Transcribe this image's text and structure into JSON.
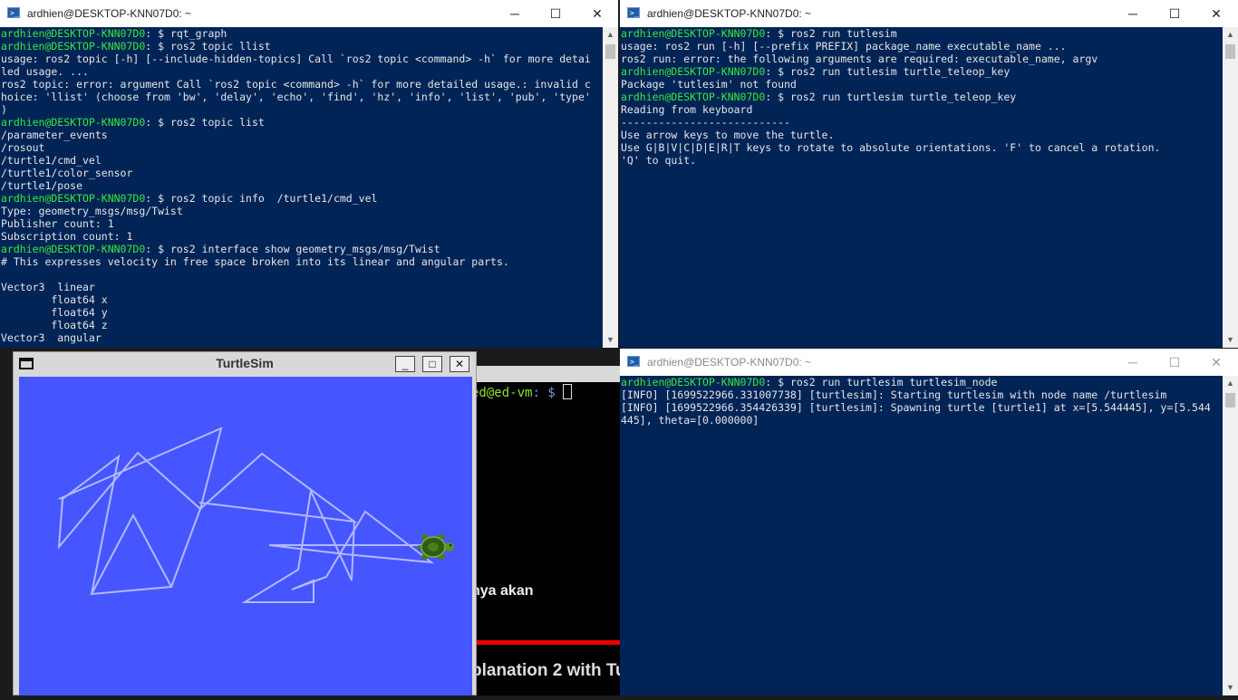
{
  "colors": {
    "terminal_bg": "#012456",
    "prompt_green": "#3ce63c",
    "turtlesim_bg": "#4556ff",
    "trail": "#b3b8ff"
  },
  "windows": {
    "top_left": {
      "title": "ardhien@DESKTOP-KNN07D0: ~",
      "controls": {
        "minimize": "─",
        "maximize": "☐",
        "close": "✕"
      },
      "lines": [
        {
          "p": "ardhien@DESKTOP-KNN07D0",
          "t": ": $ rqt_graph"
        },
        {
          "p": "ardhien@DESKTOP-KNN07D0",
          "t": ": $ ros2 topic llist"
        },
        {
          "t": "usage: ros2 topic [-h] [--include-hidden-topics] Call `ros2 topic <command> -h` for more detai"
        },
        {
          "t": "led usage. ..."
        },
        {
          "t": "ros2 topic: error: argument Call `ros2 topic <command> -h` for more detailed usage.: invalid c"
        },
        {
          "t": "hoice: 'llist' (choose from 'bw', 'delay', 'echo', 'find', 'hz', 'info', 'list', 'pub', 'type'"
        },
        {
          "t": ")"
        },
        {
          "p": "ardhien@DESKTOP-KNN07D0",
          "t": ": $ ros2 topic list"
        },
        {
          "t": "/parameter_events"
        },
        {
          "t": "/rosout"
        },
        {
          "t": "/turtle1/cmd_vel"
        },
        {
          "t": "/turtle1/color_sensor"
        },
        {
          "t": "/turtle1/pose"
        },
        {
          "p": "ardhien@DESKTOP-KNN07D0",
          "t": ": $ ros2 topic info  /turtle1/cmd_vel"
        },
        {
          "t": "Type: geometry_msgs/msg/Twist"
        },
        {
          "t": "Publisher count: 1"
        },
        {
          "t": "Subscription count: 1"
        },
        {
          "p": "ardhien@DESKTOP-KNN07D0",
          "t": ": $ ros2 interface show geometry_msgs/msg/Twist"
        },
        {
          "t": "# This expresses velocity in free space broken into its linear and angular parts."
        },
        {
          "t": ""
        },
        {
          "t": "Vector3  linear"
        },
        {
          "t": "        float64 x"
        },
        {
          "t": "        float64 y"
        },
        {
          "t": "        float64 z"
        },
        {
          "t": "Vector3  angular"
        }
      ]
    },
    "top_right": {
      "title": "ardhien@DESKTOP-KNN07D0: ~",
      "controls": {
        "minimize": "─",
        "maximize": "☐",
        "close": "✕"
      },
      "lines": [
        {
          "p": "ardhien@DESKTOP-KNN07D0",
          "t": ": $ ros2 run tutlesim"
        },
        {
          "t": "usage: ros2 run [-h] [--prefix PREFIX] package_name executable_name ..."
        },
        {
          "t": "ros2 run: error: the following arguments are required: executable_name, argv"
        },
        {
          "p": "ardhien@DESKTOP-KNN07D0",
          "t": ": $ ros2 run tutlesim turtle_teleop_key"
        },
        {
          "t": "Package 'tutlesim' not found"
        },
        {
          "p": "ardhien@DESKTOP-KNN07D0",
          "t": ": $ ros2 run turtlesim turtle_teleop_key"
        },
        {
          "t": "Reading from keyboard"
        },
        {
          "t": "---------------------------"
        },
        {
          "t": "Use arrow keys to move the turtle."
        },
        {
          "t": "Use G|B|V|C|D|E|R|T keys to rotate to absolute orientations. 'F' to cancel a rotation."
        },
        {
          "t": "'Q' to quit."
        }
      ]
    },
    "bottom_right": {
      "title": "ardhien@DESKTOP-KNN07D0: ~",
      "controls": {
        "minimize": "─",
        "maximize": "☐",
        "close": "✕"
      },
      "lines": [
        {
          "p": "ardhien@DESKTOP-KNN07D0",
          "t": ": $ ros2 run turtlesim turtlesim_node"
        },
        {
          "t": "[INFO] [1699522966.331007738] [turtlesim]: Starting turtlesim with node name /turtlesim"
        },
        {
          "t": "[INFO] [1699522966.354426339] [turtlesim]: Spawning turtle [turtle1] at x=[5.544445], y=[5.544"
        },
        {
          "t": "445], theta=[0.000000]"
        }
      ]
    },
    "turtlesim": {
      "title": "TurtleSim",
      "controls": {
        "minimize": "_",
        "maximize": "□",
        "close": "✕"
      }
    },
    "video": {
      "prompt_user": "ed@ed-vm",
      "prompt_path": ": $",
      "caption1": "nya akan",
      "caption2": "planation 2 with Tu"
    }
  }
}
